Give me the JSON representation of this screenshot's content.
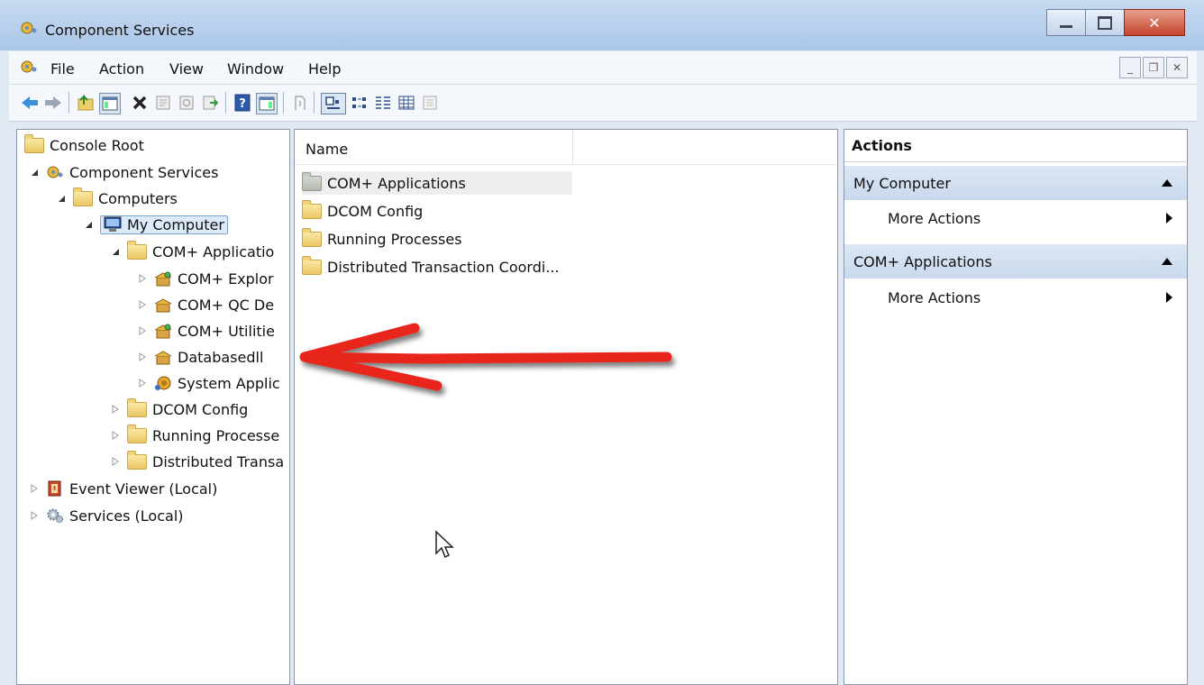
{
  "window": {
    "title": "Component Services"
  },
  "menu": [
    "File",
    "Action",
    "View",
    "Window",
    "Help"
  ],
  "toolbar": {
    "icons": [
      "back-icon",
      "forward-icon",
      "up-icon",
      "show-hide-console-tree-icon",
      "delete-icon",
      "properties-icon",
      "refresh-icon",
      "export-list-icon",
      "help-icon",
      "show-hide-action-pane-icon",
      "exit-icon",
      "large-icons-view-icon",
      "small-icons-view-icon",
      "list-view-icon",
      "details-view-icon",
      "new-window-icon"
    ]
  },
  "tree": {
    "root": "Console Root",
    "component_services": "Component Services",
    "computers": "Computers",
    "my_computer": "My Computer",
    "com_applications": "COM+ Applicatio",
    "com_explorer": "COM+ Explor",
    "com_qc": "COM+ QC De",
    "com_utilities": "COM+ Utilitie",
    "databasedll": "Databasedll",
    "system_app": "System Applic",
    "dcom_config": "DCOM Config",
    "running_processes": "Running Processe",
    "distributed_trans": "Distributed Transa",
    "event_viewer": "Event Viewer (Local)",
    "services": "Services (Local)"
  },
  "list": {
    "column_name": "Name",
    "items": [
      "COM+ Applications",
      "DCOM Config",
      "Running Processes",
      "Distributed Transaction Coordi..."
    ]
  },
  "actions": {
    "header": "Actions",
    "sections": [
      {
        "title": "My Computer",
        "item": "More Actions"
      },
      {
        "title": "COM+ Applications",
        "item": "More Actions"
      }
    ]
  },
  "colors": {
    "titlebar": "#aac6e8",
    "selection": "#dcebfb",
    "arrow": "#e8251c"
  }
}
